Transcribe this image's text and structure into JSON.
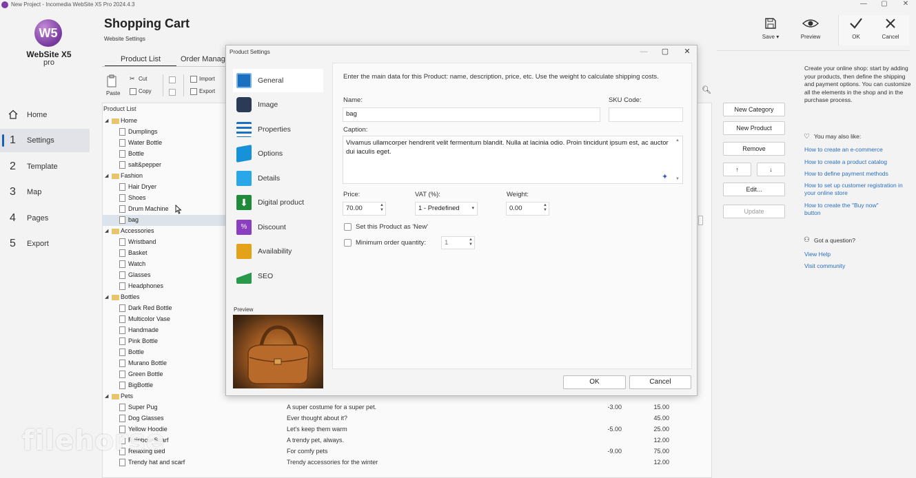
{
  "window": {
    "title": "New Project - Incomedia WebSite X5 Pro 2024.4.3",
    "minimize": "—",
    "maximize": "▢",
    "close": "✕"
  },
  "logo": {
    "mark": "W5",
    "brand": "WebSite X5",
    "edition": "pro"
  },
  "nav": [
    {
      "num": "",
      "label": "Home",
      "icon": "home-icon"
    },
    {
      "num": "1",
      "label": "Settings"
    },
    {
      "num": "2",
      "label": "Template"
    },
    {
      "num": "3",
      "label": "Map"
    },
    {
      "num": "4",
      "label": "Pages"
    },
    {
      "num": "5",
      "label": "Export"
    }
  ],
  "header": {
    "title": "Shopping Cart",
    "subtitle": "Website Settings",
    "tabs": [
      "Product List",
      "Order Manag"
    ]
  },
  "toolbar": {
    "paste": "Paste",
    "cut": "Cut",
    "copy": "Copy",
    "import": "Import",
    "export": "Export"
  },
  "topright": [
    {
      "label": "Save ▾",
      "icon": "save-icon"
    },
    {
      "label": "Preview",
      "icon": "eye-icon"
    },
    {
      "label": "OK",
      "icon": "check-icon"
    },
    {
      "label": "Cancel",
      "icon": "cancel-icon"
    }
  ],
  "product_list": {
    "header": "Product List",
    "categories": [
      {
        "name": "Home",
        "items": [
          "Dumplings",
          "Water Bottle",
          "Bottle",
          "salt&pepper"
        ]
      },
      {
        "name": "Fashion",
        "items": [
          "Hair Dryer",
          "Shoes",
          "Drum Machine",
          "bag"
        ]
      },
      {
        "name": "Accessories",
        "items": [
          "Wristband",
          "Basket",
          "Watch",
          "Glasses",
          "Headphones"
        ]
      },
      {
        "name": "Bottles",
        "items": [
          "Dark Red Bottle",
          "Multicolor Vase",
          "Handmade",
          "Pink Bottle",
          "Bottle",
          "Murano Bottle",
          "Green Bottle",
          "BigBottle"
        ]
      },
      {
        "name": "Pets",
        "items": []
      }
    ],
    "pets": [
      {
        "name": "Super Pug",
        "desc": "A super costume for a super pet.",
        "disc": "-3.00",
        "price": "15.00"
      },
      {
        "name": "Dog Glasses",
        "desc": "Ever thought about it?",
        "disc": "",
        "price": "45.00"
      },
      {
        "name": "Yellow Hoodie",
        "desc": "Let's keep them warm",
        "disc": "-5.00",
        "price": "25.00"
      },
      {
        "name": "Rainbow Scarf",
        "desc": "A trendy pet, always.",
        "disc": "",
        "price": "12.00"
      },
      {
        "name": "Relaxing Bed",
        "desc": "For comfy pets",
        "disc": "-9.00",
        "price": "75.00"
      },
      {
        "name": "Trendy hat and scarf",
        "desc": "Trendy accessories for the winter",
        "disc": "",
        "price": "12.00"
      }
    ]
  },
  "right_buttons": {
    "new_category": "New Category",
    "new_product": "New Product",
    "remove": "Remove",
    "up": "↑",
    "down": "↓",
    "edit": "Edit...",
    "update": "Update"
  },
  "help": {
    "intro": "Create your online shop: start by adding your products, then define the shipping and payment options. You can customize all the elements in the shop and in the purchase process.",
    "also_like": "You may also like:",
    "links": [
      "How to create an e-commerce",
      "How to create a product catalog",
      "How to define payment methods",
      "How to set up customer registration in your online store",
      "How to create the \"Buy now\" button"
    ],
    "question": "Got a question?",
    "help_links": [
      "View Help",
      "Visit community"
    ]
  },
  "dialog": {
    "title": "Product Settings",
    "sections": [
      {
        "label": "General",
        "icon": "general-icon",
        "color": "#1b6fc0"
      },
      {
        "label": "Image",
        "icon": "camera-icon",
        "color": "#2b3a55"
      },
      {
        "label": "Properties",
        "icon": "list-icon",
        "color": "#1b6fc0"
      },
      {
        "label": "Options",
        "icon": "cube-icon",
        "color": "#1792d8"
      },
      {
        "label": "Details",
        "icon": "details-icon",
        "color": "#2aa7e8"
      },
      {
        "label": "Digital product",
        "icon": "download-icon",
        "color": "#1f8a3a"
      },
      {
        "label": "Discount",
        "icon": "percent-icon",
        "color": "#8a3fc0"
      },
      {
        "label": "Availability",
        "icon": "box-check-icon",
        "color": "#e3a21a"
      },
      {
        "label": "SEO",
        "icon": "chart-icon",
        "color": "#2a9a4a"
      }
    ],
    "preview_label": "Preview",
    "intro": "Enter the main data for this Product: name, description, price, etc. Use the weight to calculate shipping costs.",
    "name_label": "Name:",
    "name_value": "bag",
    "sku_label": "SKU Code:",
    "sku_value": "",
    "caption_label": "Caption:",
    "caption_value": "Vivamus ullamcorper hendrerit velit fermentum blandit. Nulla at lacinia odio. Proin tincidunt ipsum est, ac auctor dui iaculis eget.",
    "price_label": "Price:",
    "price_value": "70.00",
    "vat_label": "VAT (%):",
    "vat_value": "1 - Predefined",
    "weight_label": "Weight:",
    "weight_value": "0.00",
    "new_label": "Set this Product as 'New'",
    "min_label": "Minimum order quantity:",
    "min_value": "1",
    "ok": "OK",
    "cancel": "Cancel"
  },
  "watermark": "filehorse"
}
